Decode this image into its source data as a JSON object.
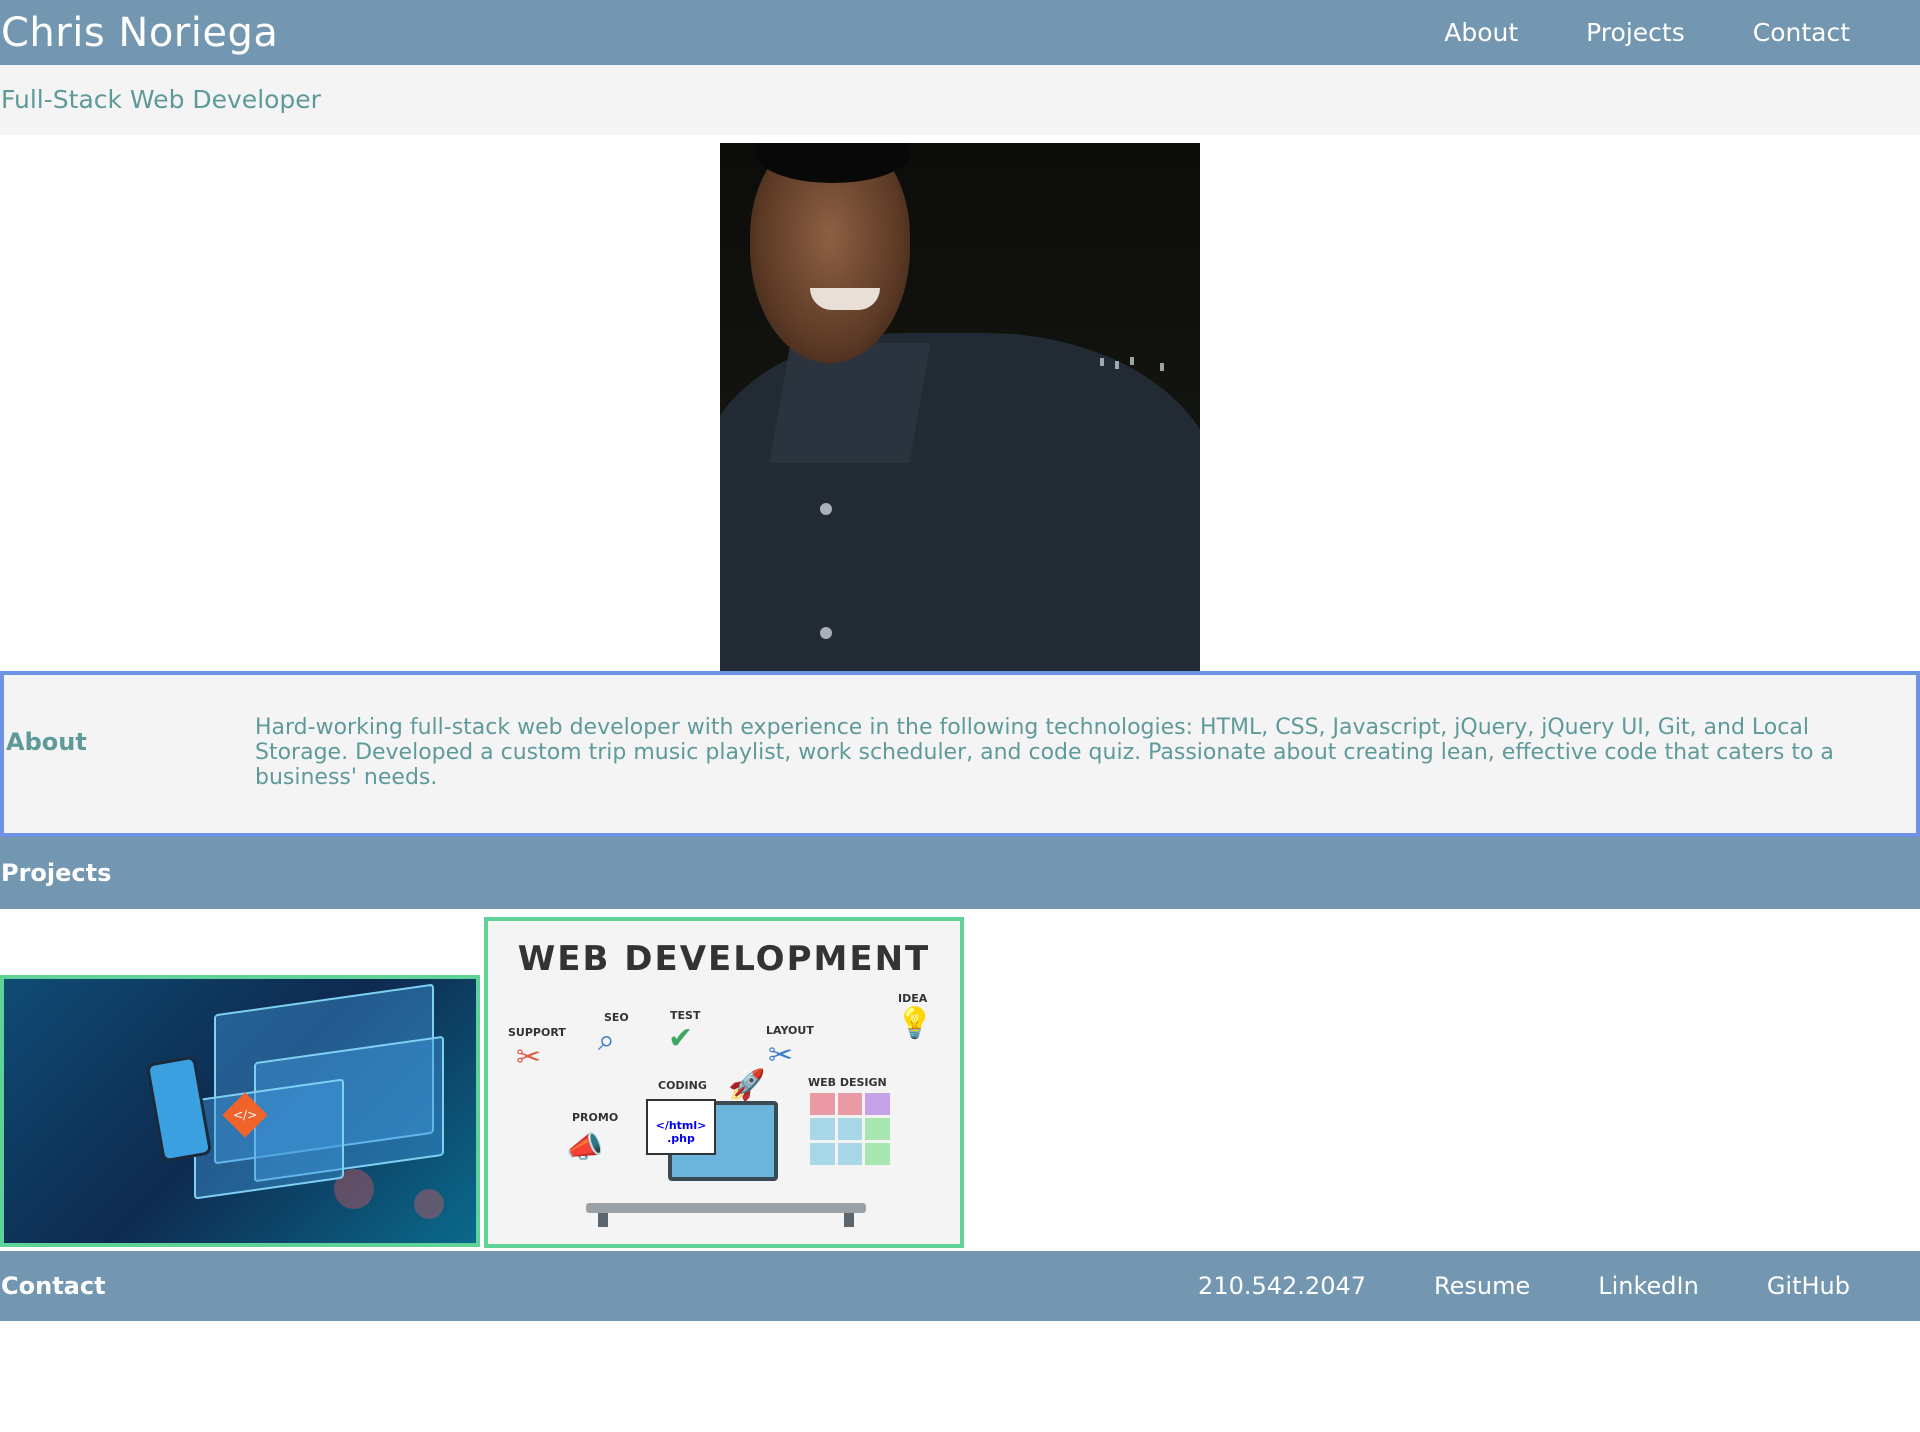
{
  "header": {
    "title": "Chris Noriega",
    "nav": [
      "About",
      "Projects",
      "Contact"
    ]
  },
  "subtitle": "Full-Stack Web Developer",
  "about": {
    "heading": "About",
    "text": "Hard-working full-stack web developer with experience in the following technologies: HTML, CSS, Javascript, jQuery, jQuery UI, Git, and Local Storage. Developed a custom trip music playlist, work scheduler, and code quiz. Passionate about creating lean, effective code that caters to a business' needs."
  },
  "projects": {
    "heading": "Projects",
    "web_dev_image": {
      "title": "WEB DEVELOPMENT",
      "labels": {
        "support": "SUPPORT",
        "seo": "SEO",
        "test": "TEST",
        "layout": "LAYOUT",
        "idea": "IDEA",
        "coding": "CODING",
        "promo": "PROMO",
        "web_design": "WEB DESIGN",
        "window_code": "</html> .php"
      }
    }
  },
  "contact": {
    "heading": "Contact",
    "phone": "210.542.2047",
    "links": [
      "Resume",
      "LinkedIn",
      "GitHub"
    ]
  },
  "colors": {
    "header_bg": "#7396b1",
    "subtitle_bg": "#f4f4f4",
    "text_teal": "#5f9a9a",
    "about_border": "#6f93e3",
    "project_border": "#5fd397"
  }
}
